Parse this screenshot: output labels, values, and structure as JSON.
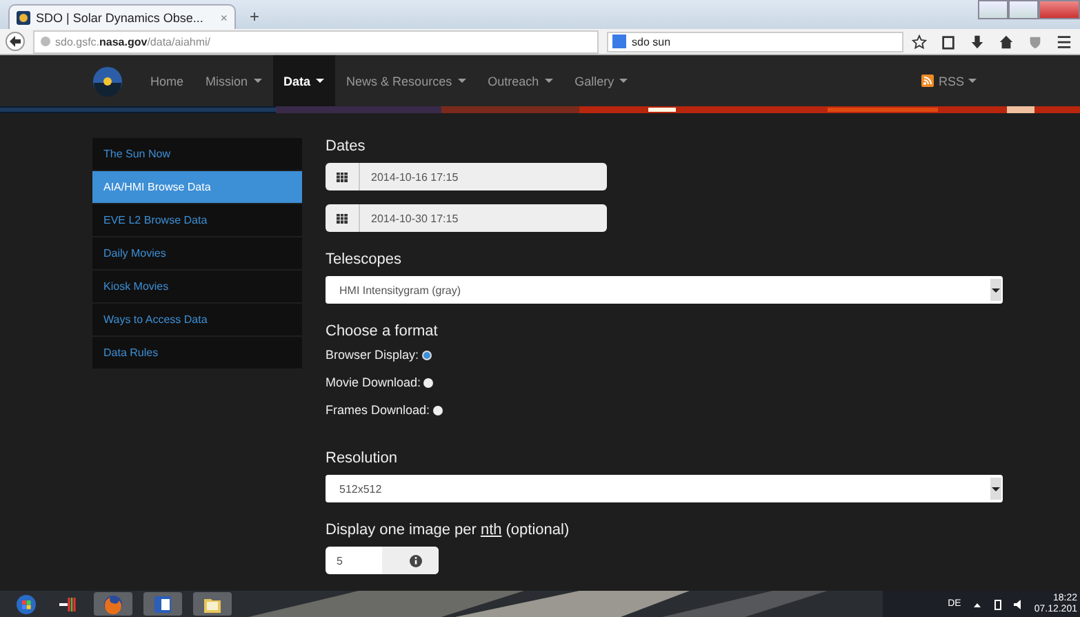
{
  "browser": {
    "tab_title": "SDO | Solar Dynamics Obse...",
    "tab_close": "×",
    "new_tab": "+",
    "url": "sdo.gsfc.**nasa.gov**/data/aiahmi/",
    "search": "sdo sun"
  },
  "nav": {
    "items": [
      {
        "label": "Home",
        "has_menu": false,
        "selected": false
      },
      {
        "label": "Mission",
        "has_menu": true,
        "selected": false
      },
      {
        "label": "Data",
        "has_menu": true,
        "selected": true
      },
      {
        "label": "News & Resources",
        "has_menu": true,
        "selected": false
      },
      {
        "label": "Outreach",
        "has_menu": true,
        "selected": false
      },
      {
        "label": "Gallery",
        "has_menu": true,
        "selected": false
      }
    ],
    "rss": "RSS"
  },
  "sidebar": {
    "items": [
      {
        "label": "The Sun Now",
        "selected": false
      },
      {
        "label": "AIA/HMI Browse Data",
        "selected": true
      },
      {
        "label": "EVE L2 Browse Data",
        "selected": false
      },
      {
        "label": "Daily Movies",
        "selected": false
      },
      {
        "label": "Kiosk Movies",
        "selected": false
      },
      {
        "label": "Ways to Access Data",
        "selected": false
      },
      {
        "label": "Data Rules",
        "selected": false
      }
    ]
  },
  "form": {
    "dates_label": "Dates",
    "dates": [
      "2014-10-16 17:15",
      "2014-10-30 17:15"
    ],
    "telescopes_label": "Telescopes",
    "telescope": "HMI Intensitygram (gray)",
    "format_label": "Choose a format",
    "formats": [
      {
        "label": "Browser Display:",
        "selected": true
      },
      {
        "label": "Movie Download:",
        "selected": false
      },
      {
        "label": "Frames Download:",
        "selected": false
      }
    ],
    "resolution_label": "Resolution",
    "resolution": "512x512",
    "nth_label": {
      "before": "Display one image per",
      "link": "nth",
      "after": "(optional)"
    },
    "nth_value": "5"
  },
  "taskbar": {
    "language": "DE",
    "time": "18:22",
    "date": "07.12.201"
  }
}
